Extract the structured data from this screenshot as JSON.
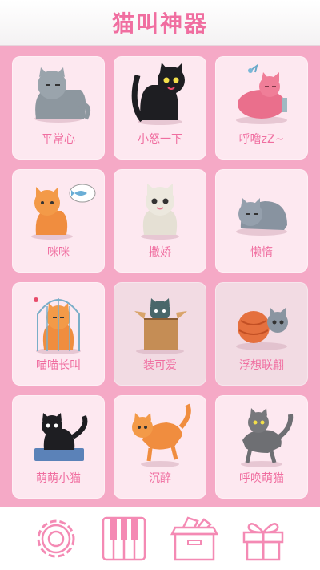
{
  "app": {
    "title": "猫叫神器"
  },
  "sounds": [
    {
      "label": "平常心",
      "icon": "gray-sitting-cat"
    },
    {
      "label": "小怒一下",
      "icon": "black-angry-cat"
    },
    {
      "label": "呼噜zZ~",
      "icon": "pink-sleeping-cat"
    },
    {
      "label": "咪咪",
      "icon": "orange-fish-thought-cat"
    },
    {
      "label": "撒娇",
      "icon": "white-cute-cat"
    },
    {
      "label": "懒惰",
      "icon": "gray-lazy-cat"
    },
    {
      "label": "喵喵长叫",
      "icon": "caged-orange-cat"
    },
    {
      "label": "装可爱",
      "icon": "cat-in-box"
    },
    {
      "label": "浮想联翩",
      "icon": "cat-with-yarn"
    },
    {
      "label": "萌萌小猫",
      "icon": "black-kitten-in-litter"
    },
    {
      "label": "沉醉",
      "icon": "orange-jumping-cat"
    },
    {
      "label": "呼唤萌猫",
      "icon": "gray-walking-cat"
    }
  ],
  "toolbar": [
    "settings-icon",
    "piano-icon",
    "box-icon",
    "gift-icon"
  ],
  "colors": {
    "accent": "#f06ea0",
    "background": "#f5a9c6",
    "card": "#fde8f0"
  }
}
